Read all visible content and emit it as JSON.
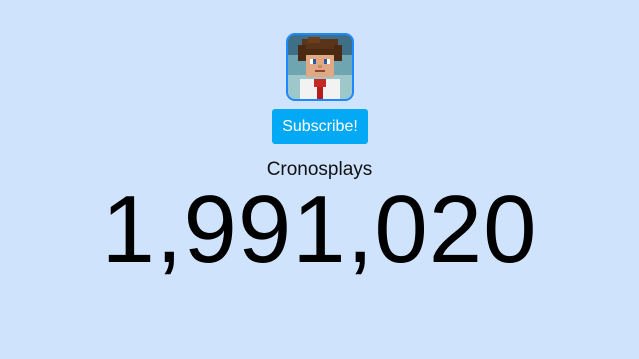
{
  "channel": {
    "name": "Cronosplays",
    "subscriber_count": "1,991,020",
    "avatar_icon": "minecraft-skin-avatar-icon"
  },
  "subscribe_button": {
    "label": "Subscribe!"
  },
  "colors": {
    "background": "#cfe3fd",
    "subscribe_button": "#03a9f4",
    "avatar_border": "#1e88ff"
  }
}
